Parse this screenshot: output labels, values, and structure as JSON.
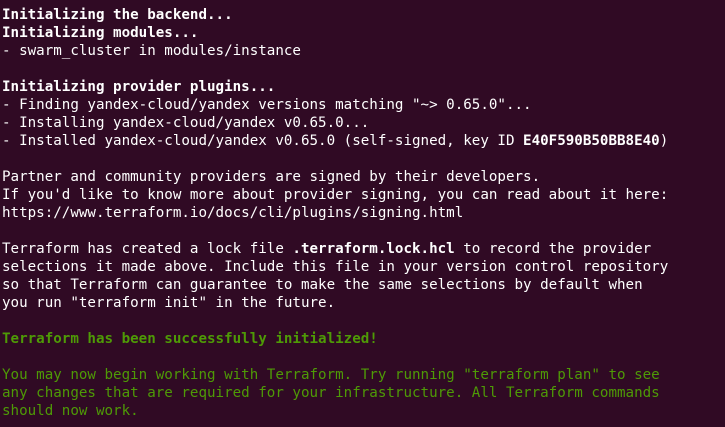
{
  "colors": {
    "background": "#300a24",
    "text": "#ffffff",
    "success": "#4e9a06"
  },
  "terminal": {
    "init_backend": "Initializing the backend...",
    "init_modules": "Initializing modules...",
    "module_line": "- swarm_cluster in modules/instance",
    "init_plugins": "Initializing provider plugins...",
    "plugin_find": "- Finding yandex-cloud/yandex versions matching \"~> 0.65.0\"...",
    "plugin_install": "- Installing yandex-cloud/yandex v0.65.0...",
    "plugin_installed_prefix": "- Installed yandex-cloud/yandex v0.65.0 (self-signed, key ID ",
    "plugin_key_id": "E40F590B50BB8E40",
    "plugin_installed_suffix": ")",
    "partner_line1": "Partner and community providers are signed by their developers.",
    "partner_line2": "If you'd like to know more about provider signing, you can read about it here:",
    "partner_link": "https://www.terraform.io/docs/cli/plugins/signing.html",
    "lock_line1_prefix": "Terraform has created a lock file ",
    "lock_file": ".terraform.lock.hcl",
    "lock_line1_suffix": " to record the provider",
    "lock_line2": "selections it made above. Include this file in your version control repository",
    "lock_line3": "so that Terraform can guarantee to make the same selections by default when",
    "lock_line4": "you run \"terraform init\" in the future.",
    "success": "Terraform has been successfully initialized!",
    "next_line1": "You may now begin working with Terraform. Try running \"terraform plan\" to see",
    "next_line2": "any changes that are required for your infrastructure. All Terraform commands",
    "next_line3": "should now work."
  }
}
